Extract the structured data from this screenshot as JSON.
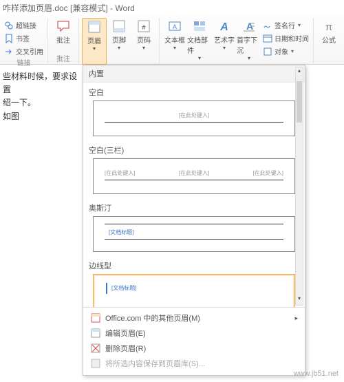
{
  "titlebar": "咋样添加页眉.doc [兼容模式] - Word",
  "ribbon": {
    "links": {
      "hyperlink": "超链接",
      "bookmark": "书签",
      "crossref": "交叉引用",
      "group": "链接"
    },
    "comments": {
      "comment": "批注",
      "group": "批注"
    },
    "headerfooter": {
      "header": "页眉",
      "footer": "页脚",
      "pagenum": "页码"
    },
    "text": {
      "textbox": "文本框",
      "quickparts": "文档部件",
      "wordart": "艺术字",
      "dropcap": "首字下沉",
      "signature": "签名行",
      "datetime": "日期和时间",
      "object": "对象"
    },
    "symbols": {
      "equation": "公式"
    }
  },
  "dropdown": {
    "builtin": "内置",
    "opts": {
      "blank": {
        "label": "空白",
        "ph": "[在此处键入]"
      },
      "blank3": {
        "label": "空白(三栏)",
        "ph1": "[在此处键入]",
        "ph2": "[在此处键入]",
        "ph3": "[在此处键入]"
      },
      "austin": {
        "label": "奥斯汀",
        "ph": "[文档标题]"
      },
      "sideline": {
        "label": "边线型",
        "ph": "[文档标题]"
      }
    },
    "footer": {
      "more": "Office.com 中的其他页眉(M)",
      "edit": "编辑页眉(E)",
      "remove": "删除页眉(R)",
      "save": "将所选内容保存到页眉库(S)..."
    }
  },
  "docText": {
    "l1": "些材料时候，要求设置",
    "l2": "绍一下。",
    "l3": "如图"
  },
  "watermark": "www.jb51.net"
}
